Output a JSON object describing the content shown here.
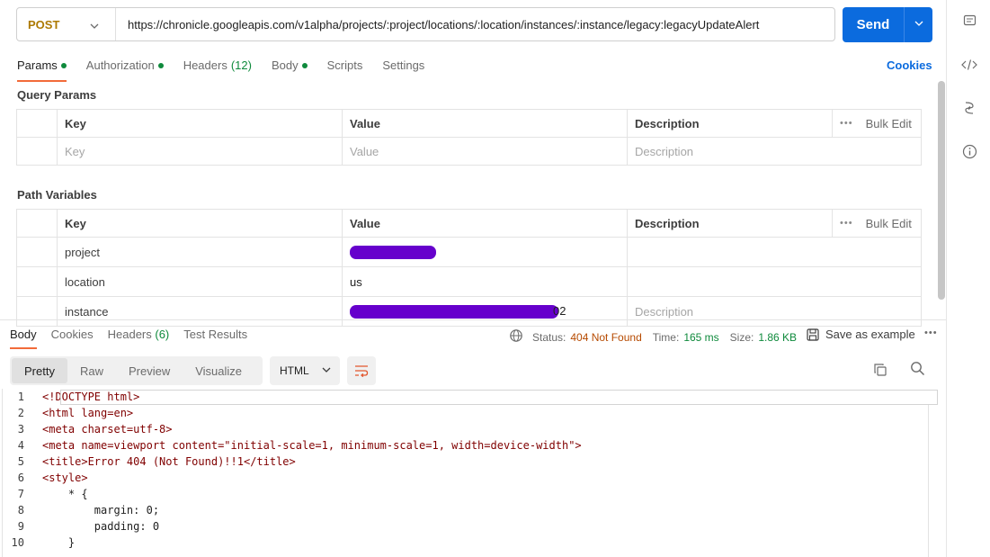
{
  "request": {
    "method": "POST",
    "url": "https://chronicle.googleapis.com/v1alpha/projects/:project/locations/:location/instances/:instance/legacy:legacyUpdateAlert",
    "send_label": "Send"
  },
  "tabs": {
    "params": "Params",
    "authorization": "Authorization",
    "headers": "Headers",
    "headers_count": "(12)",
    "body": "Body",
    "scripts": "Scripts",
    "settings": "Settings",
    "cookies": "Cookies"
  },
  "query_params": {
    "title": "Query Params",
    "headers": [
      "Key",
      "Value",
      "Description"
    ],
    "bulk_edit": "Bulk Edit",
    "placeholders": {
      "key": "Key",
      "value": "Value",
      "description": "Description"
    }
  },
  "path_variables": {
    "title": "Path Variables",
    "headers": [
      "Key",
      "Value",
      "Description"
    ],
    "bulk_edit": "Bulk Edit",
    "rows": [
      {
        "key": "project",
        "value": "",
        "value_redacted": true
      },
      {
        "key": "location",
        "value": "us"
      },
      {
        "key": "instance",
        "value": "02",
        "value_redacted": true,
        "description_placeholder": "Description"
      }
    ]
  },
  "response": {
    "tabs": {
      "body": "Body",
      "cookies": "Cookies",
      "headers": "Headers",
      "headers_count": "(6)",
      "test_results": "Test Results"
    },
    "status_label": "Status:",
    "status_value": "404 Not Found",
    "time_label": "Time:",
    "time_value": "165 ms",
    "size_label": "Size:",
    "size_value": "1.86 KB",
    "save_example": "Save as example",
    "views": [
      "Pretty",
      "Raw",
      "Preview",
      "Visualize"
    ],
    "format": "HTML",
    "code_lines": [
      {
        "n": "1",
        "text": "<!DOCTYPE html>"
      },
      {
        "n": "2",
        "text": "<html lang=en>"
      },
      {
        "n": "3",
        "text": "<meta charset=utf-8>"
      },
      {
        "n": "4",
        "text": "<meta name=viewport content=\"initial-scale=1, minimum-scale=1, width=device-width\">"
      },
      {
        "n": "5",
        "text": "<title>Error 404 (Not Found)!!1</title>"
      },
      {
        "n": "6",
        "text": "<style>"
      },
      {
        "n": "7",
        "text": "    * {"
      },
      {
        "n": "8",
        "text": "        margin: 0;"
      },
      {
        "n": "9",
        "text": "        padding: 0"
      },
      {
        "n": "10",
        "text": "    }"
      }
    ]
  },
  "colors": {
    "accent": "#0b6bde",
    "tab_underline": "#f26b3a",
    "status_error": "#b64a00",
    "ok_green": "#0f8a3c",
    "method": "#ad7a03"
  }
}
